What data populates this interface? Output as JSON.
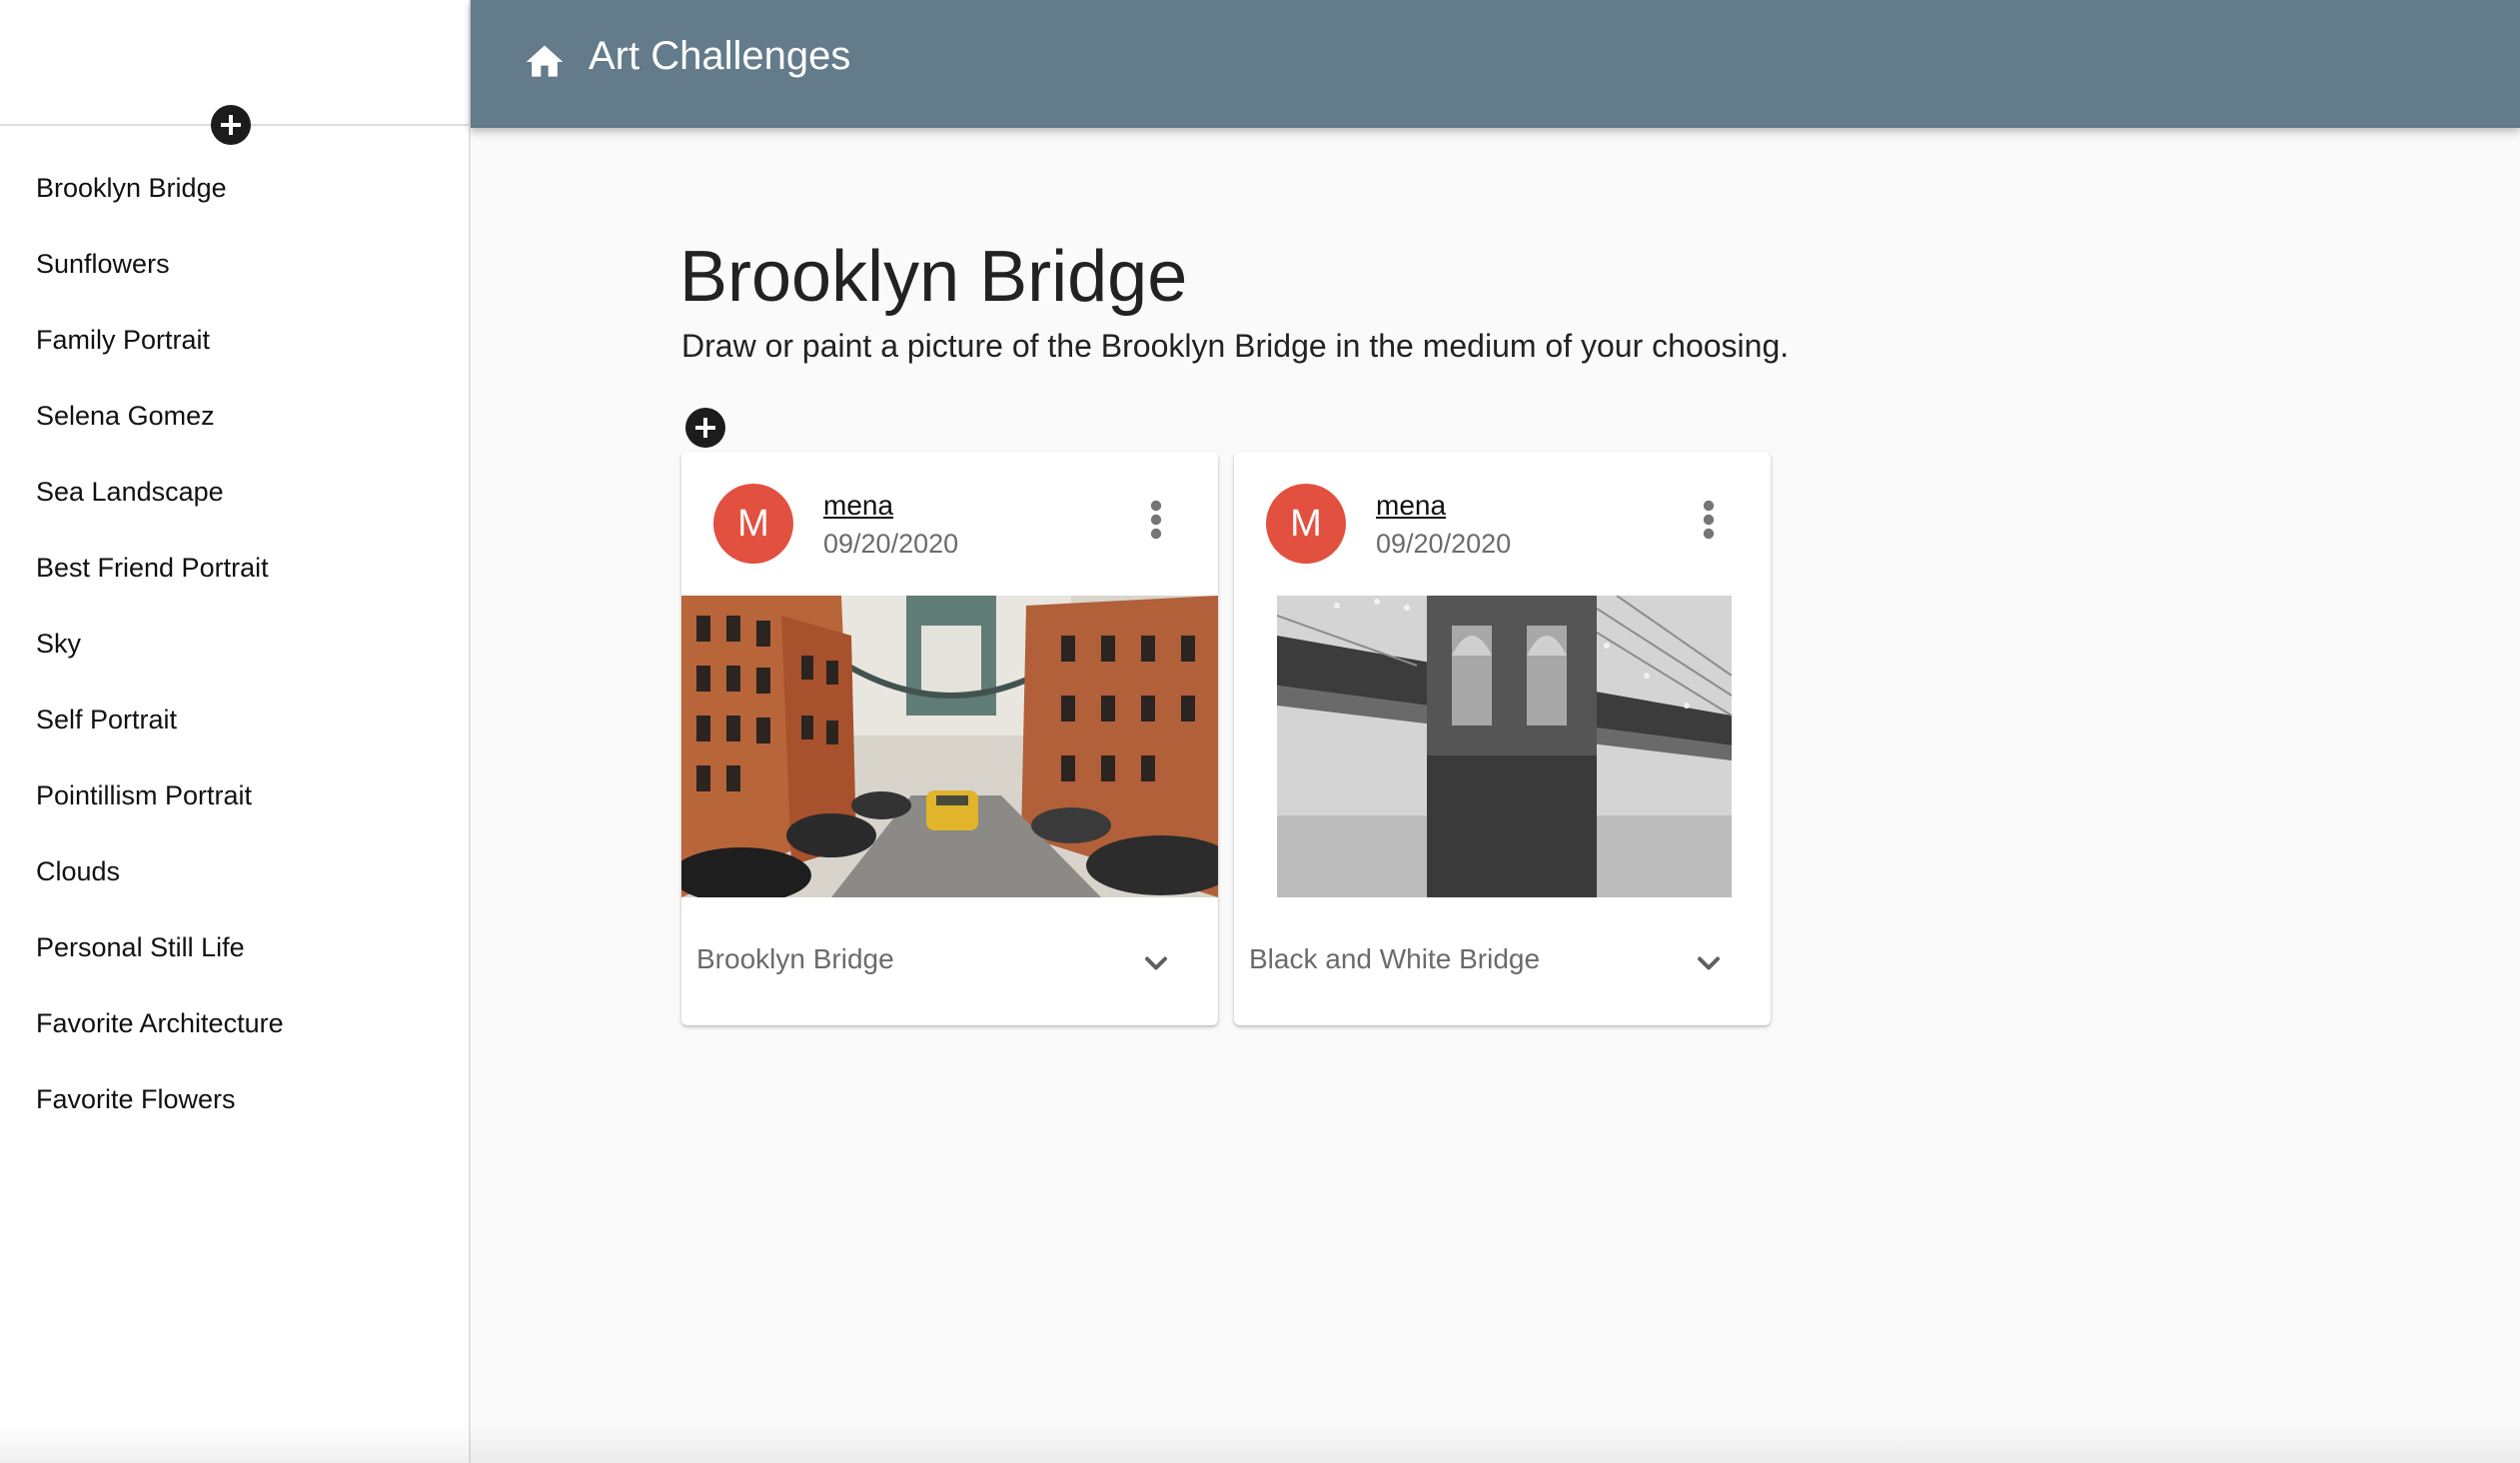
{
  "app": {
    "title": "Art Challenges"
  },
  "sidebar": {
    "items": [
      {
        "label": "Brooklyn Bridge"
      },
      {
        "label": "Sunflowers"
      },
      {
        "label": "Family Portrait"
      },
      {
        "label": "Selena Gomez"
      },
      {
        "label": "Sea Landscape"
      },
      {
        "label": "Best Friend Portrait"
      },
      {
        "label": "Sky"
      },
      {
        "label": "Self Portrait"
      },
      {
        "label": "Pointillism Portrait"
      },
      {
        "label": "Clouds"
      },
      {
        "label": "Personal Still Life"
      },
      {
        "label": "Favorite Architecture"
      },
      {
        "label": "Favorite Flowers"
      }
    ]
  },
  "main": {
    "title": "Brooklyn Bridge",
    "description": "Draw or paint a picture of the Brooklyn Bridge in the medium of your choosing."
  },
  "cards": [
    {
      "avatar_initial": "M",
      "user": "mena",
      "date": "09/20/2020",
      "caption": "Brooklyn Bridge"
    },
    {
      "avatar_initial": "M",
      "user": "mena",
      "date": "09/20/2020",
      "caption": "Black and White Bridge"
    }
  ],
  "colors": {
    "appbar": "#637b8a",
    "avatar": "#e25040",
    "background": "#fafafa"
  },
  "icons": {
    "home": "home-icon",
    "add": "add-circle-icon",
    "more": "more-vert-icon",
    "expand": "chevron-down-icon"
  }
}
